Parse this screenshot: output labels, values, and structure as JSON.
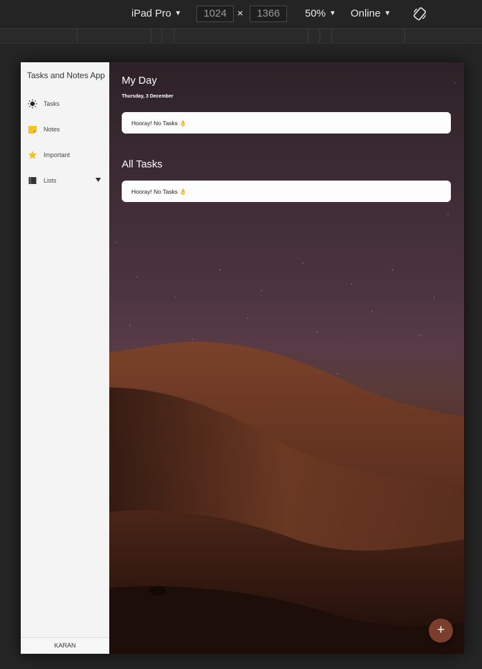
{
  "devtools": {
    "device_label": "iPad Pro",
    "width": "1024",
    "times": "×",
    "height": "1366",
    "zoom_label": "50%",
    "network_label": "Online",
    "rotate_icon": "rotate-device-icon"
  },
  "sidebar": {
    "app_title": "Tasks and Notes App",
    "items": [
      {
        "label": "Tasks",
        "icon": "sun-icon"
      },
      {
        "label": "Notes",
        "icon": "note-icon"
      },
      {
        "label": "Important",
        "icon": "star-icon"
      },
      {
        "label": "Lists",
        "icon": "book-icon"
      }
    ],
    "footer_user": "KARAN"
  },
  "main": {
    "my_day": {
      "title": "My Day",
      "date": "Thursday, 3 December",
      "empty_message": "Hooray! No Tasks 👌"
    },
    "all_tasks": {
      "title": "All Tasks",
      "empty_message": "Hooray! No Tasks 👌"
    },
    "add_button": "+"
  },
  "colors": {
    "accent_fab": "#7a3f2c",
    "notes_icon": "#f2c12e",
    "star_icon": "#f2c12e"
  }
}
